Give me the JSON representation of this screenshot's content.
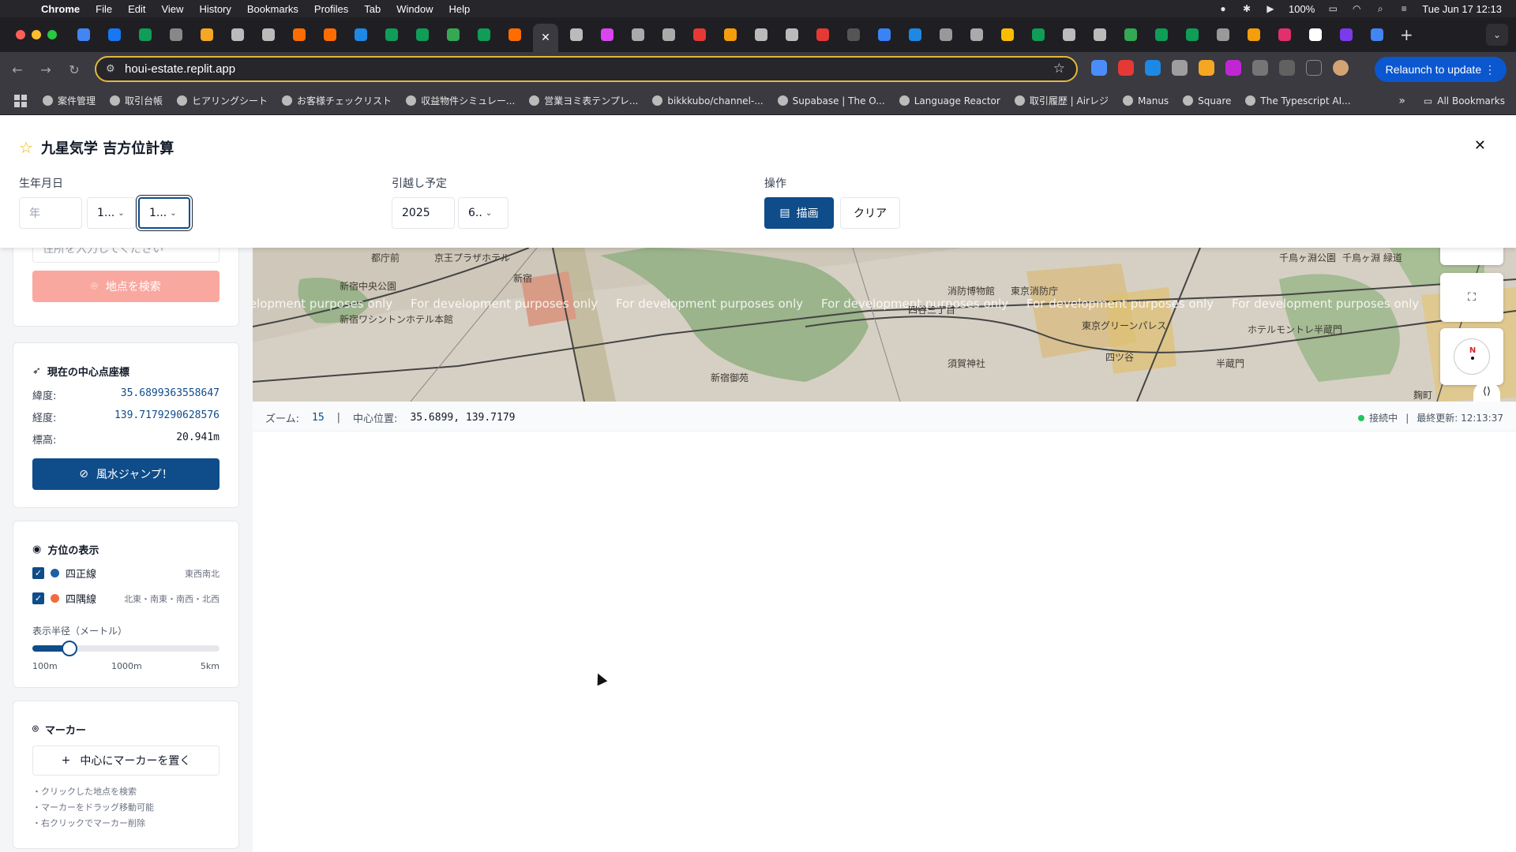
{
  "menubar": {
    "app": "Chrome",
    "items": [
      "File",
      "Edit",
      "View",
      "History",
      "Bookmarks",
      "Profiles",
      "Tab",
      "Window",
      "Help"
    ],
    "battery": "100%",
    "datetime": "Tue Jun 17  12:13"
  },
  "toolbar": {
    "url": "houi-estate.replit.app",
    "relaunch_label": "Relaunch to update"
  },
  "bookmarks": {
    "items": [
      "案件管理",
      "取引台帳",
      "ヒアリングシート",
      "お客様チェックリスト",
      "収益物件シミュレー...",
      "営業ヨミ表テンプレ...",
      "bikkkubo/channel-...",
      "Supabase | The O...",
      "Language Reactor",
      "取引履歴 | Airレジ",
      "Manus",
      "Square",
      "The Typescript AI..."
    ],
    "more": "»",
    "all_label": "All Bookmarks"
  },
  "header": {
    "title": "九星気学 吉方位計算",
    "birth_label": "生年月日",
    "birth_year_placeholder": "年",
    "birth_month": "1...",
    "birth_day": "1...",
    "move_label": "引越し予定",
    "move_year": "2025",
    "move_month": "6..",
    "ops_label": "操作",
    "draw_label": "描画",
    "clear_label": "クリア"
  },
  "search": {
    "address_placeholder": "住所を入力してください",
    "search_button": "地点を検索"
  },
  "center": {
    "heading": "現在の中心点座標",
    "lat_label": "緯度:",
    "lat_value": "35.6899363558647",
    "lng_label": "経度:",
    "lng_value": "139.7179290628576",
    "alt_label": "標高:",
    "alt_value": "20.941m",
    "jump_button": "風水ジャンプ！"
  },
  "directions": {
    "heading": "方位の表示",
    "line1_label": "四正線",
    "line1_hint": "東西南北",
    "line1_checked": true,
    "line1_color": "#1d5fa8",
    "line2_label": "四隅線",
    "line2_hint": "北東・南東・南西・北西",
    "line2_checked": true,
    "line2_color": "#f26b3a",
    "radius_label": "表示半径（メートル）",
    "radius_fraction": 0.2,
    "ticks": [
      "100m",
      "1000m",
      "5km"
    ]
  },
  "marker": {
    "heading": "マーカー",
    "add_button": "中心にマーカーを置く",
    "notes": [
      "・クリックした地点を検索",
      "・マーカーをドラッグ移動可能",
      "・右クリックでマーカー削除"
    ]
  },
  "map": {
    "watermark": "For development purposes only",
    "labels": [
      "都庁前",
      "新宿中央公園",
      "新宿ワシントンホテル本館",
      "新宿",
      "新宿御苑",
      "四谷三丁目",
      "須賀神社",
      "消防博物館",
      "東京消防庁",
      "東京グリーンパレス",
      "四ツ谷",
      "ホテルモントレ半蔵門",
      "半蔵門",
      "千鳥ヶ淵公園",
      "千鳥ヶ淵 緑道",
      "京王プラザホテル",
      "麹町"
    ],
    "compass_n": "N"
  },
  "status": {
    "zoom_label": "ズーム:",
    "zoom_value": "15",
    "sep": "|",
    "center_label": "中心位置:",
    "center_value": "35.6899, 139.7179",
    "connection": "接続中",
    "updated": "最終更新: 12:13:37"
  }
}
